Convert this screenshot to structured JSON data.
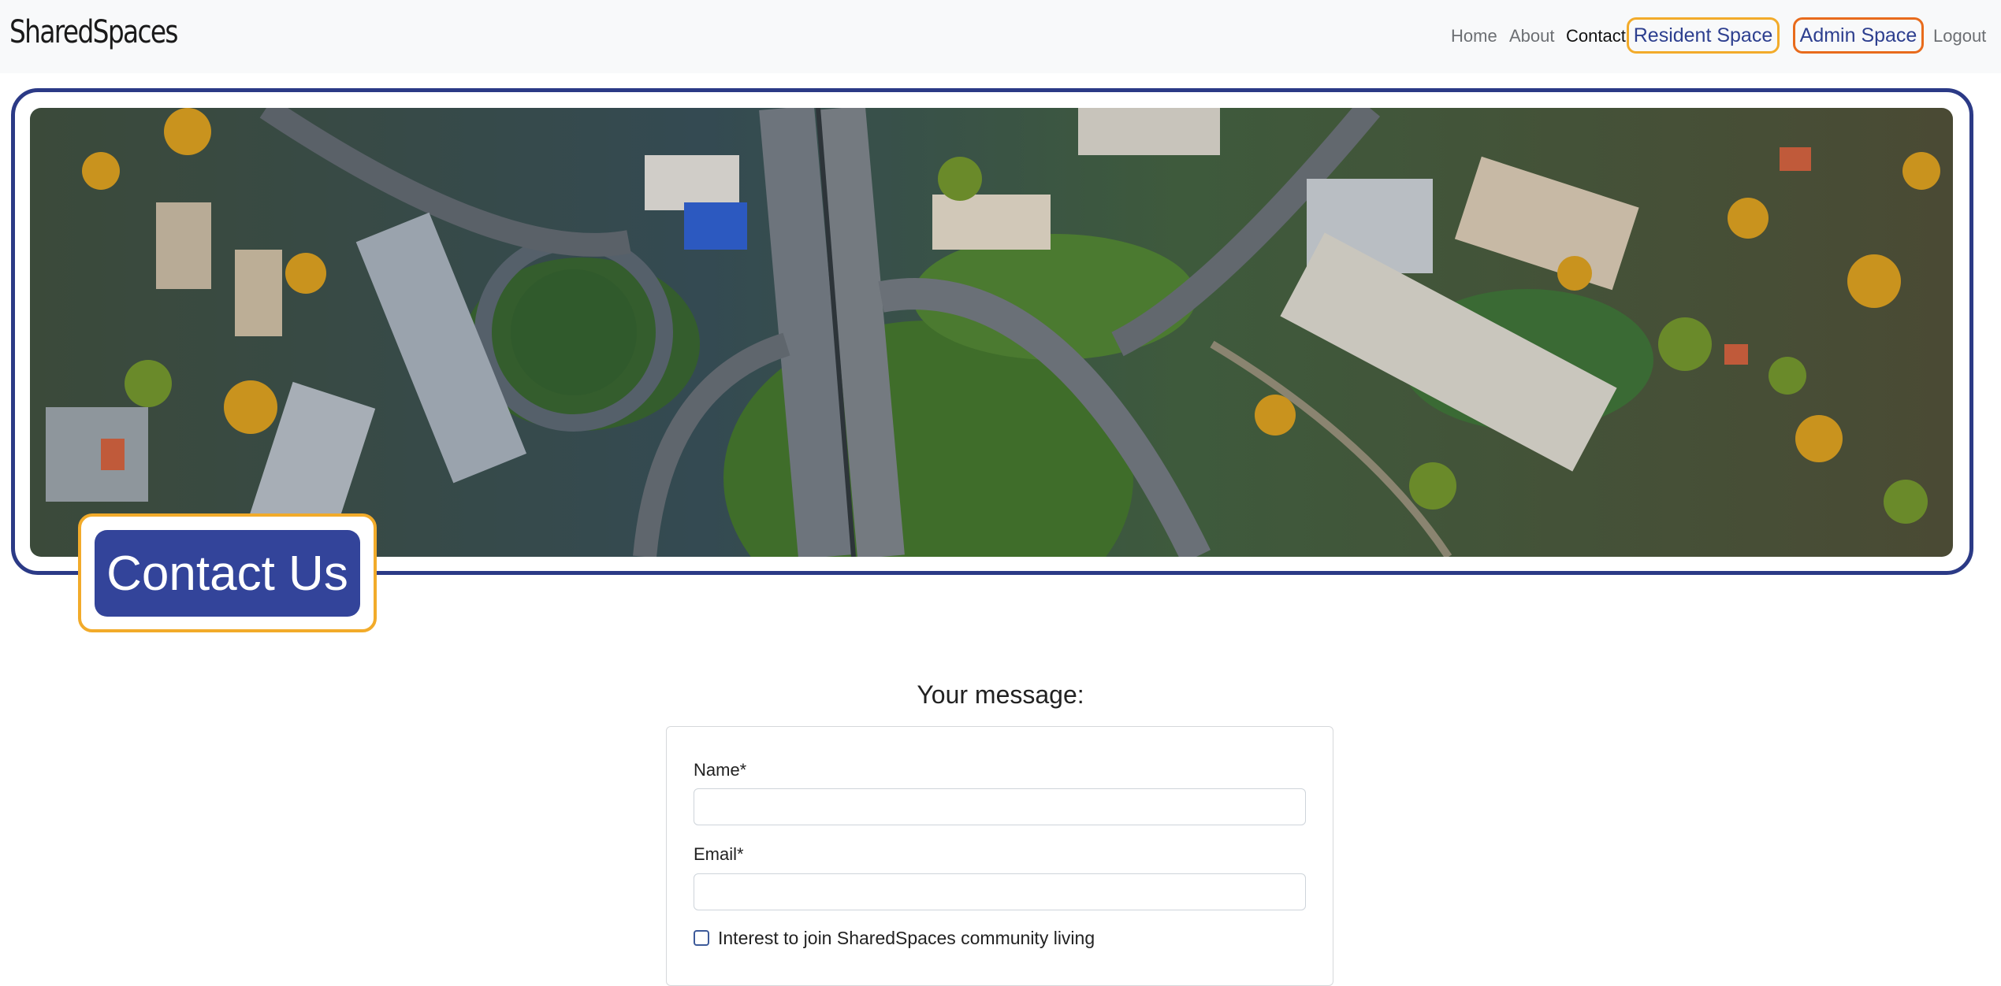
{
  "navbar": {
    "brand": "SharedSpaces",
    "links": {
      "home": "Home",
      "about": "About",
      "contact": "Contact",
      "logout": "Logout"
    },
    "resident_space": "Resident Space",
    "admin_space": "Admin Space"
  },
  "hero": {
    "title": "Contact Us"
  },
  "form": {
    "heading": "Your message:",
    "name_label": "Name*",
    "email_label": "Email*",
    "interest_label": "Interest to join SharedSpaces community living"
  },
  "colors": {
    "navy": "#2b3a86",
    "title_bg": "#33449a",
    "accent_orange": "#f2ab2a",
    "admin_orange": "#e86b1c"
  }
}
